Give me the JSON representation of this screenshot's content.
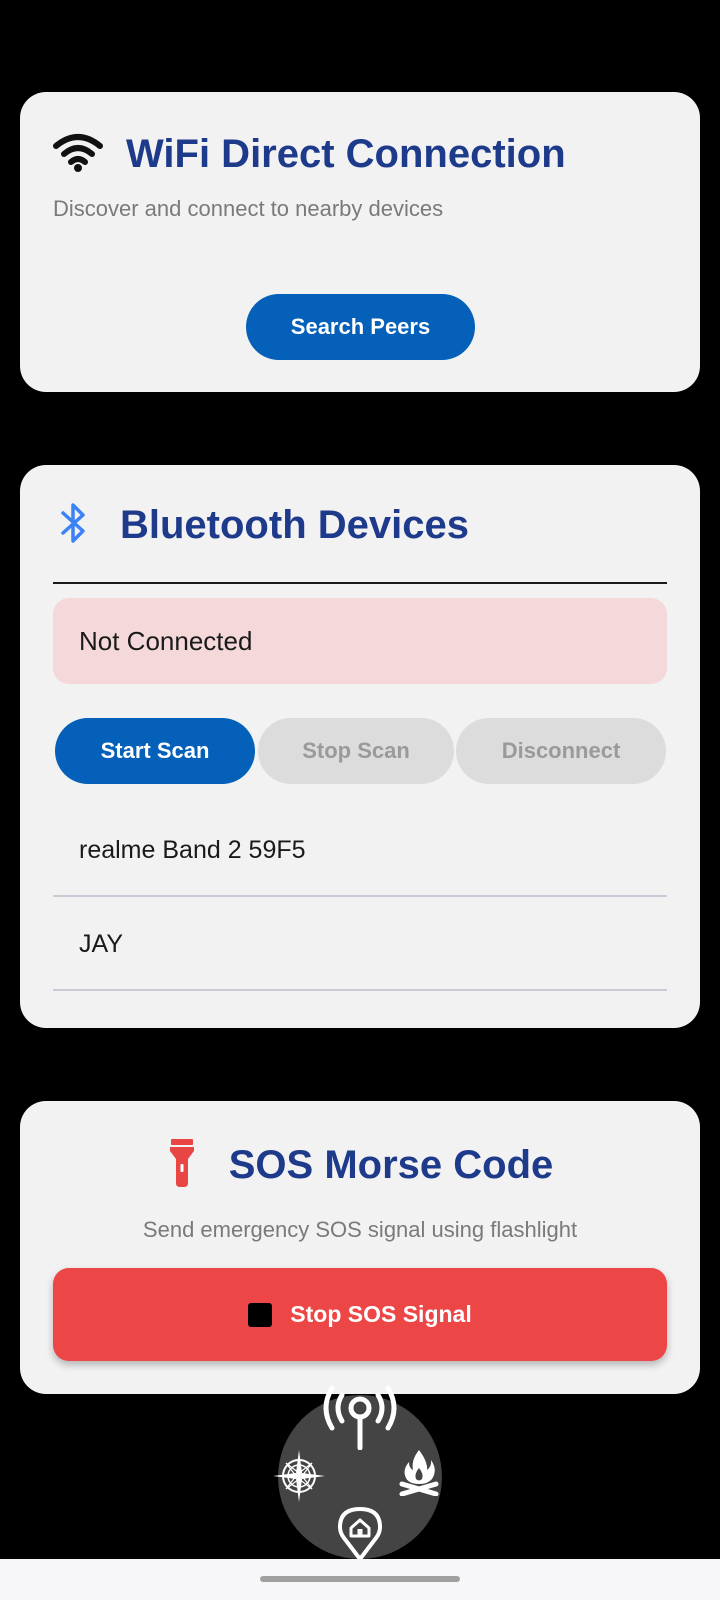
{
  "wifi": {
    "title": "WiFi Direct Connection",
    "subtitle": "Discover and connect to nearby devices",
    "search_label": "Search Peers",
    "icon": "wifi-icon"
  },
  "bluetooth": {
    "title": "Bluetooth Devices",
    "icon": "bluetooth-icon",
    "status": "Not Connected",
    "start_scan_label": "Start Scan",
    "stop_scan_label": "Stop Scan",
    "disconnect_label": "Disconnect",
    "devices": [
      {
        "name": "realme Band 2 59F5"
      },
      {
        "name": "JAY"
      }
    ]
  },
  "sos": {
    "title": "SOS Morse Code",
    "subtitle": "Send emergency SOS signal using flashlight",
    "button_label": "Stop SOS Signal",
    "icon": "flashlight-icon",
    "button_icon": "stop-icon"
  },
  "radial_menu": {
    "items": [
      "radio-tower-icon",
      "compass-icon",
      "campfire-icon",
      "home-pin-icon"
    ]
  },
  "colors": {
    "accent": "#0460b8",
    "title": "#1e3a8a",
    "danger": "#ec4646",
    "status_bg": "#f5d9da",
    "bluetooth": "#3b82f6"
  }
}
